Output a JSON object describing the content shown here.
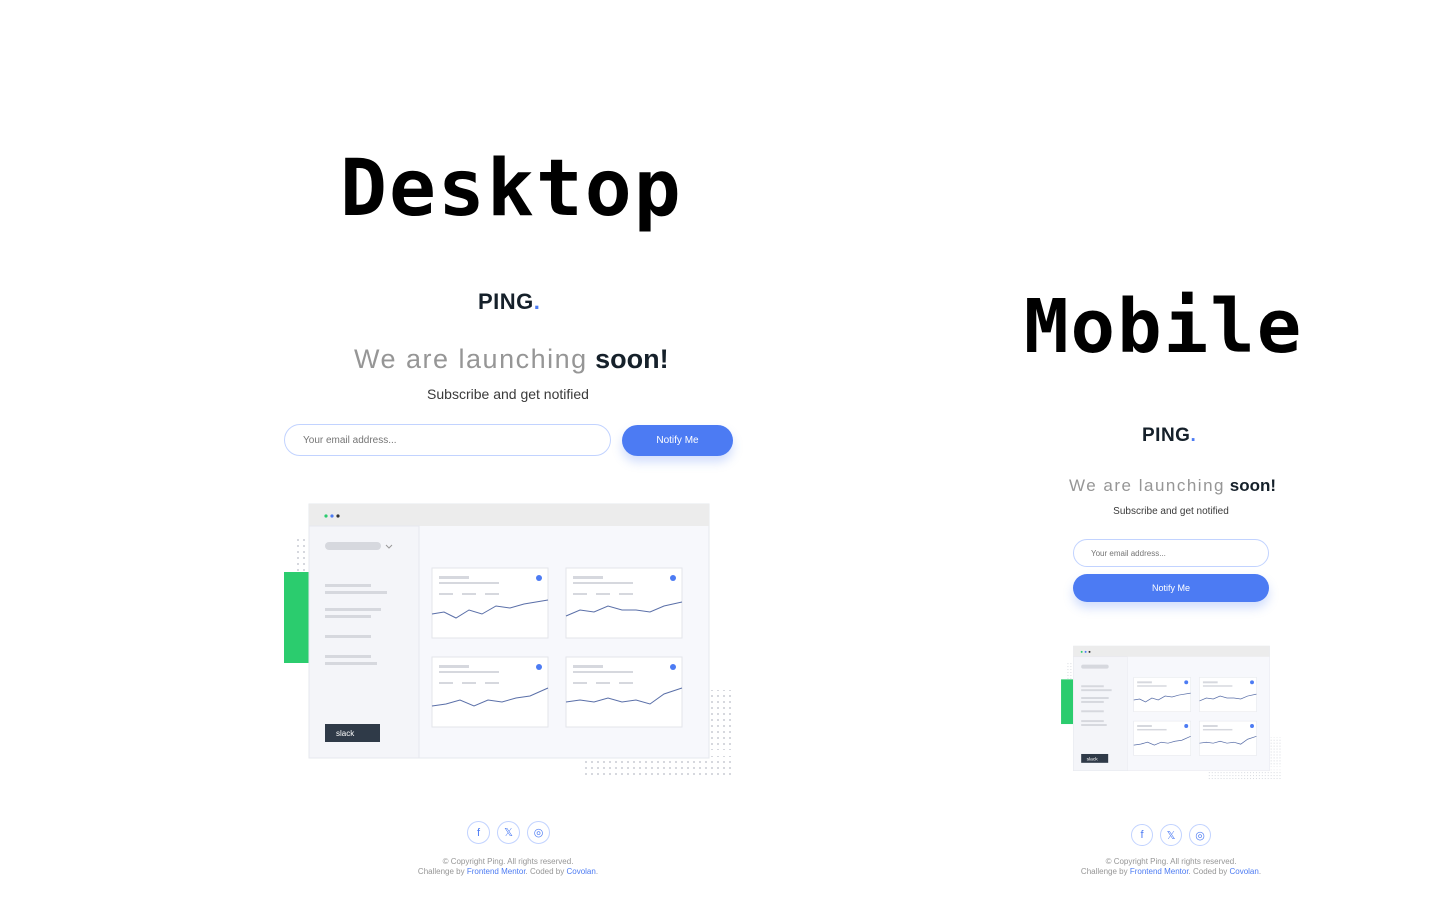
{
  "headings": {
    "desktop": "Desktop",
    "mobile": "Mobile"
  },
  "brand": {
    "name": "PING",
    "dot": "."
  },
  "hero": {
    "title_light": "We are launching",
    "title_bold": "soon!",
    "subtitle": "Subscribe and get notified"
  },
  "form": {
    "email_placeholder": "Your email address...",
    "button_label": "Notify Me"
  },
  "dashboard": {
    "slack_label": "slack"
  },
  "socials": [
    {
      "icon": "facebook-icon",
      "glyph": "f"
    },
    {
      "icon": "x-icon",
      "glyph": "𝕏"
    },
    {
      "icon": "instagram-icon",
      "glyph": "◎"
    }
  ],
  "footer": {
    "copyright": "© Copyright Ping. All rights reserved.",
    "challenge_prefix": "Challenge by ",
    "challenge_link": "Frontend Mentor",
    "coded_prefix": ". Coded by ",
    "coded_link": "Covolan",
    "suffix": "."
  },
  "colors": {
    "accent": "#4c7bf3",
    "text_dark": "#15202a",
    "text_gray": "#969696",
    "input_border": "#c2d3ff",
    "green": "#2bcc6e"
  }
}
